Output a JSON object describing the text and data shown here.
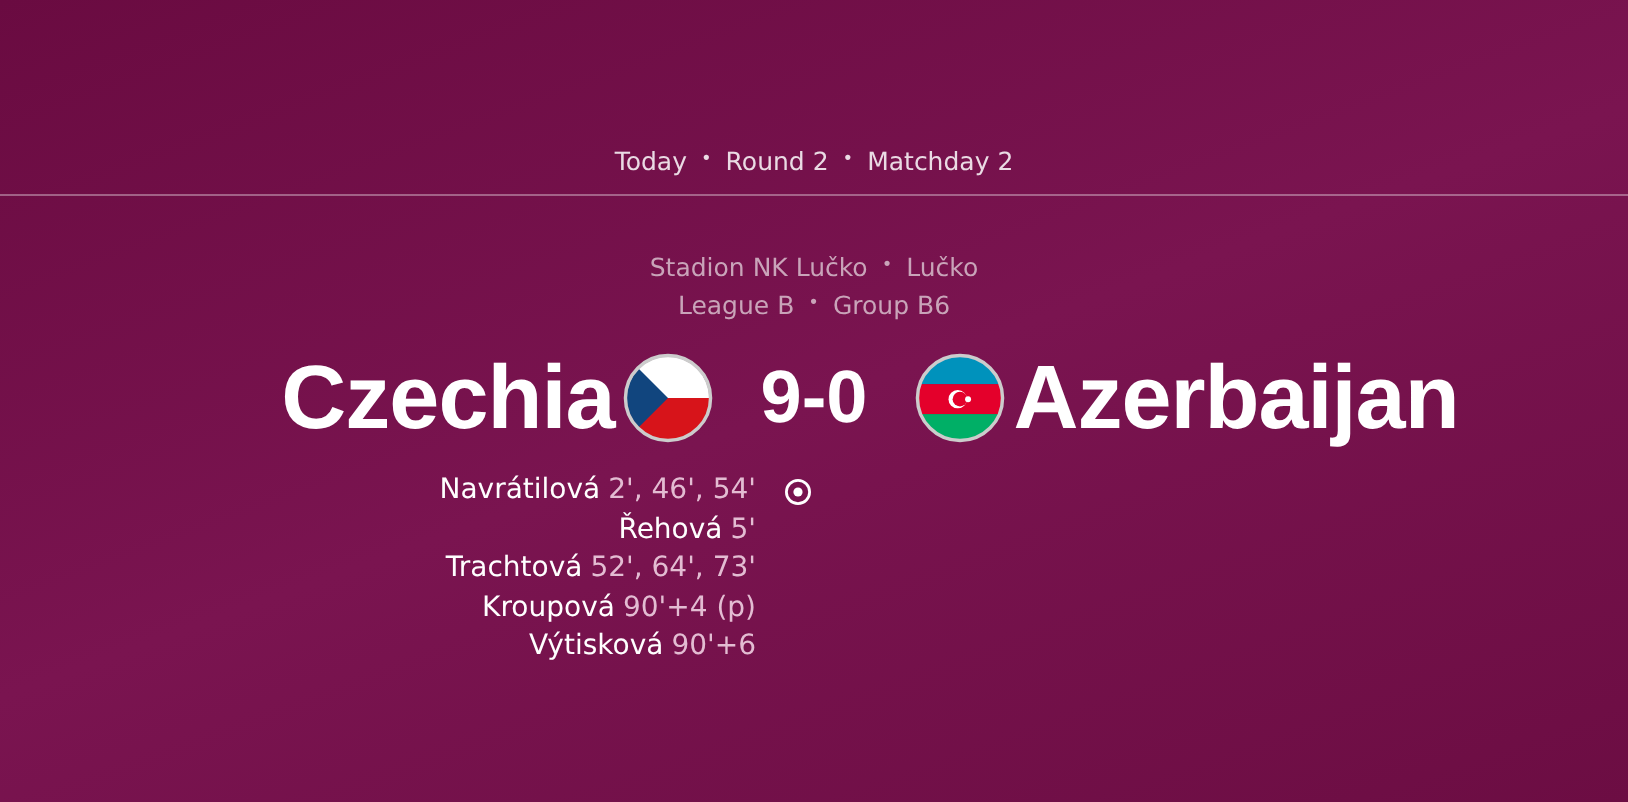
{
  "header": {
    "items": [
      "Today",
      "Round 2",
      "Matchday 2"
    ],
    "separator": "•"
  },
  "venue": {
    "lines": [
      [
        "Stadion NK Lučko",
        "Lučko"
      ],
      [
        "League B",
        "Group B6"
      ]
    ],
    "separator": "•"
  },
  "match": {
    "home": {
      "name": "Czechia",
      "kind": "cz"
    },
    "score": "9-0",
    "away": {
      "name": "Azerbaijan",
      "kind": "az"
    }
  },
  "scorers": [
    {
      "name": "Navrátilová",
      "minutes": "2', 46', 54'"
    },
    {
      "name": "Řehová",
      "minutes": "5'"
    },
    {
      "name": "Trachtová",
      "minutes": "52', 64', 73'"
    },
    {
      "name": "Kroupová",
      "minutes": "90'+4 (p)"
    },
    {
      "name": "Výtisková",
      "minutes": "90'+6"
    }
  ]
}
